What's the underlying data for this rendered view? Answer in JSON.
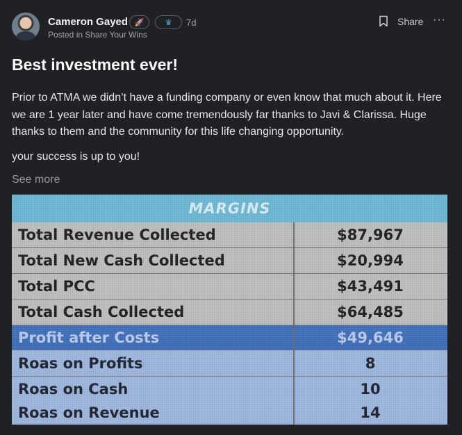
{
  "post": {
    "author": "Cameron Gayed",
    "badge_rocket_icon": "rocket-icon",
    "badge_crown_icon": "crown-icon",
    "age": "7d",
    "posted_in": "Posted in Share Your Wins",
    "share_label": "Share",
    "more_label": "···",
    "title": "Best investment ever!",
    "paragraph1": "Prior to ATMA we didn’t have a funding company or even know that much about it. Here we are 1 year later and have come tremendously far thanks to Javi & Clarissa. Huge thanks to them and the community for this life changing opportunity.",
    "paragraph2": "your success is up to you!",
    "see_more": "See more"
  },
  "photo": {
    "header": "MARGINS",
    "rows": [
      {
        "label": "Total Revenue Collected",
        "value": "$87,967"
      },
      {
        "label": "Total New Cash Collected",
        "value": "$20,994"
      },
      {
        "label": "Total PCC",
        "value": "$43,491"
      },
      {
        "label": "Total Cash Collected",
        "value": "$64,485"
      },
      {
        "label": "Profit after Costs",
        "value": "$49,646"
      },
      {
        "label": "Roas on Profits",
        "value": "8"
      },
      {
        "label": "Roas on Cash",
        "value": "10"
      },
      {
        "label": "Roas on Revenue",
        "value": "14"
      }
    ]
  },
  "colors": {
    "background": "#202124",
    "header_cyan": "#6cb7d4",
    "highlight_blue": "#3f6fb8",
    "pale_blue": "#9cb6dc"
  }
}
